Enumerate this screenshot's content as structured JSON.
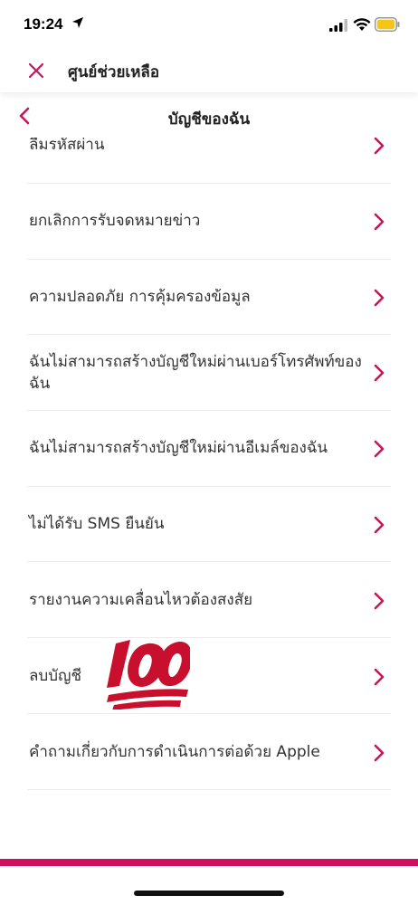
{
  "status_bar": {
    "time": "19:24",
    "battery_color": "#f5c518"
  },
  "help_header": {
    "title": "ศูนย์ช่วยเหลือ"
  },
  "nav": {
    "title": "บัญชีของฉัน"
  },
  "accent_color": "#c2185b",
  "items": [
    {
      "label": "ลืมรหัสผ่าน"
    },
    {
      "label": "ยกเลิกการรับจดหมายข่าว"
    },
    {
      "label": "ความปลอดภัย การคุ้มครองข้อมูล"
    },
    {
      "label": "ฉันไม่สามารถสร้างบัญชีใหม่ผ่านเบอร์โทรศัพท์ของฉัน"
    },
    {
      "label": "ฉันไม่สามารถสร้างบัญชีใหม่ผ่านอีเมล์ของฉัน"
    },
    {
      "label": "ไม่ได้รับ SMS ยืนยัน"
    },
    {
      "label": "รายงานความเคลื่อนไหวต้องสงสัย"
    },
    {
      "label": "ลบบัญชี"
    },
    {
      "label": "คำถามเกี่ยวกับการดำเนินการต่อด้วย Apple"
    }
  ],
  "icons": {
    "close": "close-icon",
    "back": "chevron-left-icon",
    "chevron": "chevron-right-icon",
    "sticker": "hundred-points-icon"
  }
}
